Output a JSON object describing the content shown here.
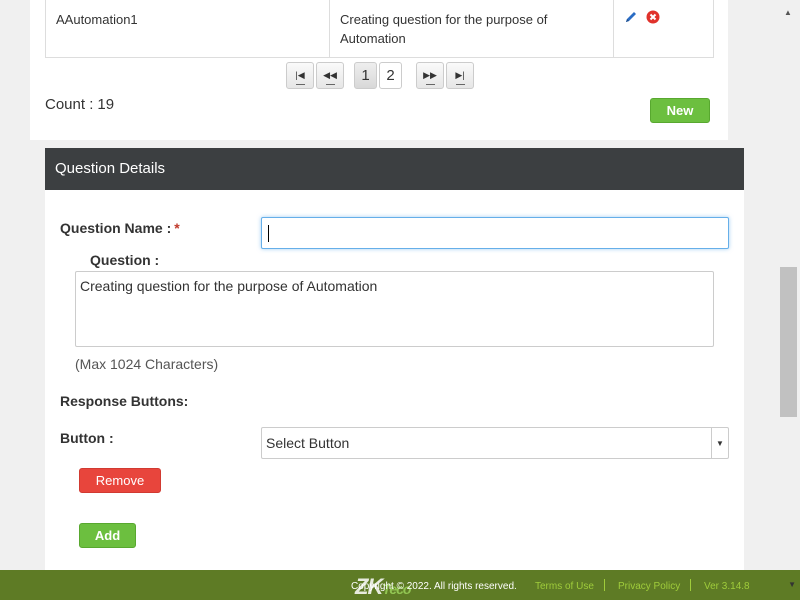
{
  "table": {
    "row": {
      "name": "AAutomation1",
      "question": "Creating question for the purpose of Automation"
    }
  },
  "pager": {
    "first": "|◀",
    "prev": "◀◀",
    "next": "▶▶",
    "last": "▶|",
    "pages": [
      "1",
      "2"
    ]
  },
  "count": {
    "label": "Count :",
    "value": "19"
  },
  "new_button": "New",
  "details": {
    "title": "Question Details",
    "question_name_label": "Question Name :",
    "required_mark": "*",
    "question_label": "Question :",
    "question_value": "Creating question for the purpose of Automation",
    "max_hint": "(Max 1024 Characters)",
    "response_buttons_label": "Response Buttons:",
    "button_label": "Button :",
    "select_value": "Select Button",
    "remove_button": "Remove",
    "add_button": "Add"
  },
  "footer": {
    "logo_main": "ZK",
    "logo_sub": "Teco",
    "copyright": "Copyright © 2022. All rights reserved.",
    "terms": "Terms of Use",
    "privacy": "Privacy Policy",
    "version": "Ver 3.14.8"
  },
  "colors": {
    "header_bg": "#3c3f41",
    "green": "#6cbf3f",
    "red": "#e8453c",
    "footer_bg": "#5e7b25",
    "link": "#9fcc3b"
  }
}
